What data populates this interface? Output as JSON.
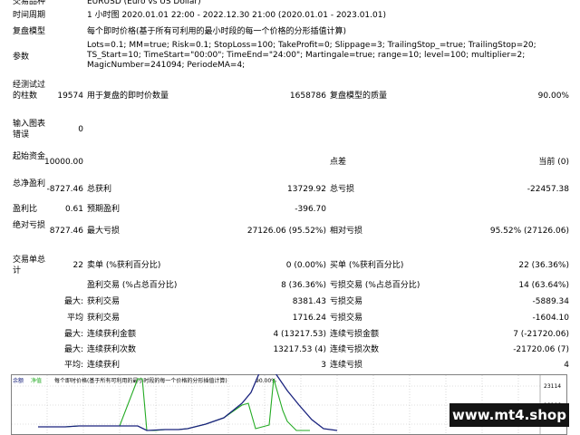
{
  "top": {
    "symbol_label": "交易品种",
    "symbol_value": "EURUSD (Euro vs US Dollar)",
    "period_label": "时间周期",
    "period_value": "1 小时图 2020.01.01 22:00 - 2022.12.30 21:00 (2020.01.01 - 2023.01.01)",
    "model_label": "复盘模型",
    "model_value": "每个即时价格(基于所有可利用的最小时段的每一个价格的分形插值计算)",
    "params_label": "参数",
    "params_value": "Lots=0.1; MM=true; Risk=0.1; StopLoss=100; TakeProfit=0; Slippage=3; TrailingStop_=true; TrailingStop=20; TS_Start=10; TimeStart=\"00:00\"; TimeEnd=\"24:00\"; Martingale=true; range=10; level=100; multiplier=2; MagicNumber=241094; PeriodeMA=4;"
  },
  "stats": {
    "bars_label": "经测试过的柱数",
    "bars_value": "19574",
    "ticks_label": "用于复盘的即时价数量",
    "ticks_value": "1658786",
    "quality_label": "复盘模型的质量",
    "quality_value": "90.00%",
    "errors_label": "输入图表错误",
    "errors_value": "0",
    "deposit_label": "起始资金",
    "deposit_value": "10000.00",
    "spread_label": "点差",
    "spread_value": "当前 (0)",
    "netprofit_label": "总净盈利",
    "netprofit_value": "-8727.46",
    "grossprofit_label": "总获利",
    "grossprofit_value": "13729.92",
    "grossloss_label": "总亏损",
    "grossloss_value": "-22457.38",
    "pf_label": "盈利比",
    "pf_value": "0.61",
    "expected_label": "预期盈利",
    "expected_value": "-396.70",
    "absdd_label": "绝对亏损",
    "absdd_value": "8727.46",
    "maxdd_label": "最大亏损",
    "maxdd_value": "27126.06 (95.52%)",
    "reldd_label": "相对亏损",
    "reldd_value": "95.52% (27126.06)",
    "trades_label": "交易单总计",
    "trades_value": "22",
    "short_label": "卖单 (%获利百分比)",
    "short_value": "0 (0.00%)",
    "long_label": "买单 (%获利百分比)",
    "long_value": "22 (36.36%)",
    "win_label": "盈利交易 (%占总百分比)",
    "win_value": "8 (36.36%)",
    "loss_label": "亏损交易 (%占总百分比)",
    "loss_value": "14 (63.64%)",
    "max1_label": "最大:",
    "largest_win_label": "获利交易",
    "largest_win_value": "8381.43",
    "largest_loss_label": "亏损交易",
    "largest_loss_value": "-5889.34",
    "avg1_label": "平均",
    "avg_win_label": "获利交易",
    "avg_win_value": "1716.24",
    "avg_loss_label": "亏损交易",
    "avg_loss_value": "-1604.10",
    "max2_label": "最大:",
    "cons_win_amt_label": "连续获利金额",
    "cons_win_amt_value": "4 (13217.53)",
    "cons_loss_amt_label": "连续亏损金额",
    "cons_loss_amt_value": "7 (-21720.06)",
    "max3_label": "最大:",
    "cons_win_cnt_label": "连续获利次数",
    "cons_win_cnt_value": "13217.53 (4)",
    "cons_loss_cnt_label": "连续亏损次数",
    "cons_loss_cnt_value": "-21720.06 (7)",
    "avg2_label": "平均:",
    "avg_cons_win_label": "连续获利",
    "avg_cons_win_value": "3",
    "avg_cons_loss_label": "连续亏损",
    "avg_cons_loss_value": "4"
  },
  "chart": {
    "legend_balance": "余额",
    "legend_equity": "净值",
    "legend_model": "每个即时价格(基于所有可利用的最小时段的每一个价格的分形插值计算)",
    "legend_quality": "90.00%",
    "ytick_top": "23114",
    "ytick_mid": "18106",
    "ytick_bot": "11644",
    "balance_color": "#1a237e",
    "equity_color": "#22aa22"
  },
  "watermark": "www.mt4.shop"
}
